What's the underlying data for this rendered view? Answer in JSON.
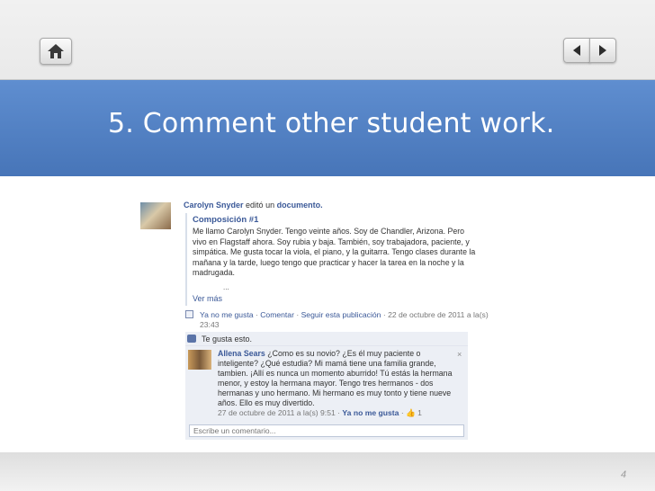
{
  "slide": {
    "title": "5. Comment other student work.",
    "page_number": "4"
  },
  "icons": {
    "home": "home-icon",
    "prev": "arrow-left-icon",
    "next": "arrow-right-icon"
  },
  "colors": {
    "title_band": "#4f7ec2",
    "fb_link": "#3b5998",
    "fb_panel": "#eceff5"
  },
  "post": {
    "author": "Carolyn Snyder",
    "action": "editó un",
    "object": "documento.",
    "doc_title": "Composición #1",
    "body": "Me llamo Carolyn Snyder.  Tengo veinte años.  Soy de Chandler, Arizona. Pero vivo en Flagstaff ahora.  Soy rubia y baja.  También, soy trabajadora, paciente, y simpática.  Me gusta tocar la viola, el piano, y la guitarra. Tengo clases durante la mañana y la tarde, luego tengo que practicar y hacer la tarea en la noche y la madrugada.",
    "ellipsis": "...",
    "see_more": "Ver más",
    "unlike": "Ya no me gusta",
    "comment": "Comentar",
    "follow": "Seguir esta publicación",
    "timestamp": "· 22 de octubre de 2011 a la(s) 23:43"
  },
  "likes": {
    "text": "Te gusta esto."
  },
  "comment": {
    "author": "Allena Sears",
    "text": "¿Como es su novio? ¿Es él muy paciente o inteligente? ¿Qué estudia? Mi mamá tiene una familia grande, tambien. ¡Allí es nunca un momento aburrido! Tú estás la hermana menor, y estoy la hermana mayor. Tengo tres hermanos - dos hermanas y uno hermano. Mi hermano es muy tonto y tiene nueve años. Ello es muy divertido.",
    "close": "×",
    "timestamp": "27 de octubre de 2011 a la(s) 9:51 ·",
    "unlike": "Ya no me gusta",
    "like_count": "· 👍 1"
  },
  "composer": {
    "placeholder": "Escribe un comentario..."
  }
}
